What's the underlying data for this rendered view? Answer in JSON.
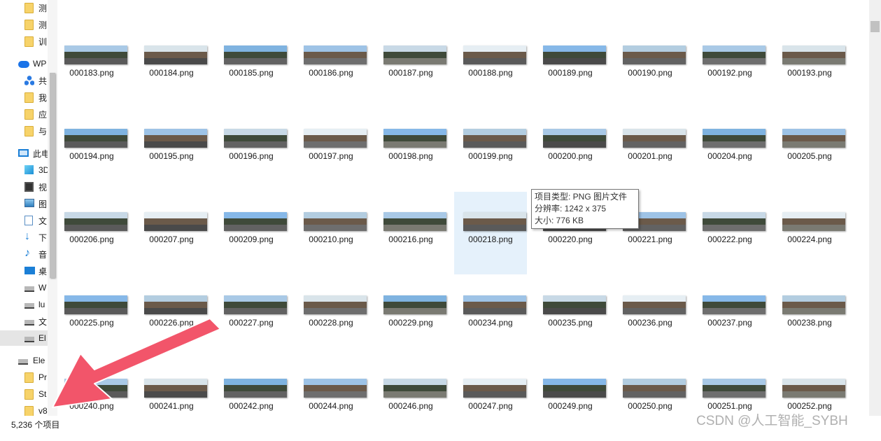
{
  "nav": {
    "items": [
      {
        "label": "测",
        "icon": "folder-icon",
        "level": 2,
        "selected": false
      },
      {
        "label": "测",
        "icon": "folder-icon",
        "level": 2,
        "selected": false
      },
      {
        "label": "训",
        "icon": "folder-icon",
        "level": 2,
        "selected": false
      },
      {
        "label": "WP",
        "icon": "cloud-icon",
        "level": 1,
        "selected": false
      },
      {
        "label": "共",
        "icon": "share-icon",
        "level": 2,
        "selected": false
      },
      {
        "label": "我",
        "icon": "folder-icon",
        "level": 2,
        "selected": false
      },
      {
        "label": "应",
        "icon": "folder-icon",
        "level": 2,
        "selected": false
      },
      {
        "label": "与",
        "icon": "folder-icon",
        "level": 2,
        "selected": false
      },
      {
        "label": "此电",
        "icon": "computer-icon",
        "level": 1,
        "selected": false
      },
      {
        "label": "3D",
        "icon": "cube-icon",
        "level": 2,
        "selected": false
      },
      {
        "label": "视",
        "icon": "video-icon",
        "level": 2,
        "selected": false
      },
      {
        "label": "图",
        "icon": "picture-icon",
        "level": 2,
        "selected": false
      },
      {
        "label": "文",
        "icon": "document-icon",
        "level": 2,
        "selected": false
      },
      {
        "label": "下",
        "icon": "download-icon",
        "level": 2,
        "selected": false
      },
      {
        "label": "音",
        "icon": "music-icon",
        "level": 2,
        "selected": false
      },
      {
        "label": "桌",
        "icon": "desktop-icon",
        "level": 2,
        "selected": false
      },
      {
        "label": "W",
        "icon": "drive-icon",
        "level": 2,
        "selected": false
      },
      {
        "label": "lu",
        "icon": "drive-icon",
        "level": 2,
        "selected": false
      },
      {
        "label": "文",
        "icon": "drive-icon",
        "level": 2,
        "selected": false
      },
      {
        "label": "El",
        "icon": "drive-icon",
        "level": 2,
        "selected": true
      },
      {
        "label": "Ele",
        "icon": "drive-icon",
        "level": 1,
        "selected": false
      },
      {
        "label": "Pr",
        "icon": "folder-icon",
        "level": 2,
        "selected": false
      },
      {
        "label": "St",
        "icon": "folder-icon",
        "level": 2,
        "selected": false
      },
      {
        "label": "v8",
        "icon": "folder-icon",
        "level": 2,
        "selected": false
      }
    ]
  },
  "files": [
    [
      "000183.png",
      "000184.png",
      "000185.png",
      "000186.png",
      "000187.png",
      "000188.png",
      "000189.png",
      "000190.png",
      "000192.png",
      "000193.png"
    ],
    [
      "000194.png",
      "000195.png",
      "000196.png",
      "000197.png",
      "000198.png",
      "000199.png",
      "000200.png",
      "000201.png",
      "000204.png",
      "000205.png"
    ],
    [
      "000206.png",
      "000207.png",
      "000209.png",
      "000210.png",
      "000216.png",
      "000218.png",
      "000220.png",
      "000221.png",
      "000222.png",
      "000224.png"
    ],
    [
      "000225.png",
      "000226.png",
      "000227.png",
      "000228.png",
      "000229.png",
      "000234.png",
      "000235.png",
      "000236.png",
      "000237.png",
      "000238.png"
    ],
    [
      "000240.png",
      "000241.png",
      "000242.png",
      "000244.png",
      "000246.png",
      "000247.png",
      "000249.png",
      "000250.png",
      "000251.png",
      "000252.png"
    ]
  ],
  "hovered_file": "000218.png",
  "tooltip": {
    "type": "项目类型: PNG 图片文件",
    "resolution": "分辨率: 1242 x 375",
    "size": "大小: 776 KB"
  },
  "status": {
    "count": "5,236 个项目"
  },
  "watermark": "CSDN @人工智能_SYBH",
  "colors": {
    "hover_bg": "#e5f1fb",
    "selected_bg": "#e5e5e5",
    "arrow": "#f2556a",
    "folder": "#f7d36a"
  }
}
